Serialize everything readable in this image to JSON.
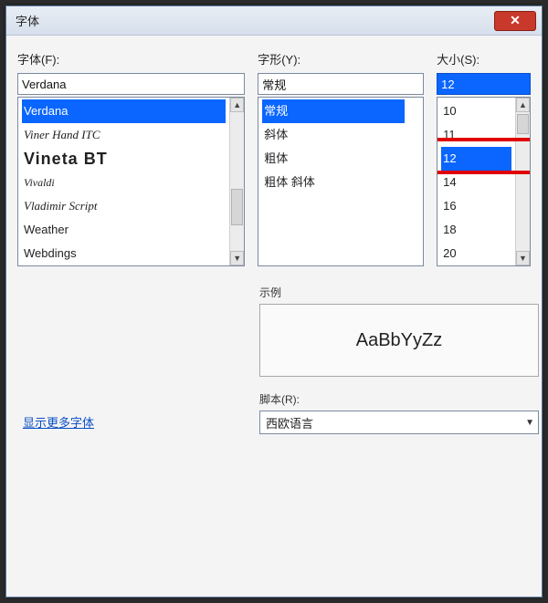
{
  "title": "字体",
  "labels": {
    "font": "字体(F):",
    "style": "字形(Y):",
    "size": "大小(S):",
    "preview_section": "示例",
    "script_section": "脚本(R):"
  },
  "inputs": {
    "font_value": "Verdana",
    "style_value": "常规",
    "size_value": "12"
  },
  "font_list": [
    {
      "label": "Verdana",
      "css": "f-verdana",
      "selected": true
    },
    {
      "label": "Viner Hand ITC",
      "css": "f-viner"
    },
    {
      "label": "Vineta BT",
      "css": "f-vineta"
    },
    {
      "label": "Vivaldi",
      "css": "f-vivaldi"
    },
    {
      "label": "Vladimir Script",
      "css": "f-vlad"
    },
    {
      "label": "Weather",
      "css": "f-weather"
    },
    {
      "label": "Webdings",
      "css": "f-webd"
    }
  ],
  "style_list": [
    {
      "label": "常规",
      "selected": true
    },
    {
      "label": "斜体"
    },
    {
      "label": "粗体"
    },
    {
      "label": "粗体 斜体"
    }
  ],
  "size_list": [
    {
      "label": "10"
    },
    {
      "label": "11"
    },
    {
      "label": "12",
      "selected": true
    },
    {
      "label": "14"
    },
    {
      "label": "16"
    },
    {
      "label": "18"
    },
    {
      "label": "20"
    }
  ],
  "preview_text": "AaBbYyZz",
  "script_combo": {
    "value": "西欧语言"
  },
  "more_link": "显示更多字体"
}
